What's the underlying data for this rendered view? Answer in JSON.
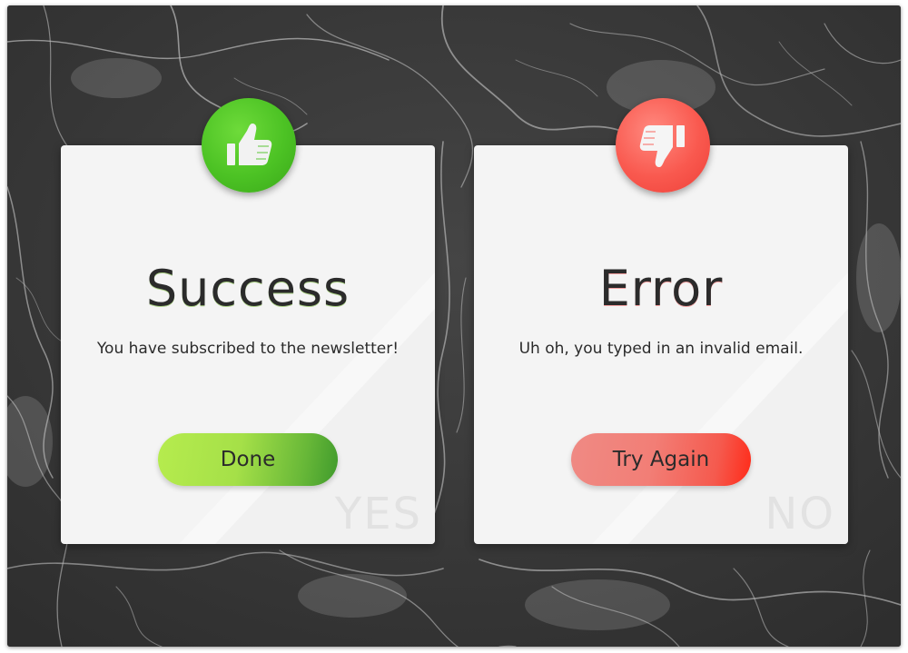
{
  "success_card": {
    "title": "Success",
    "message": "You have subscribed to the newsletter!",
    "button_label": "Done",
    "watermark": "YES",
    "icon": "thumbs-up-icon",
    "accent_color": "#4cc224"
  },
  "error_card": {
    "title": "Error",
    "message": "Uh oh, you typed in an invalid email.",
    "button_label": "Try Again",
    "watermark": "NO",
    "icon": "thumbs-down-icon",
    "accent_color": "#f9594f"
  },
  "colors": {
    "background": "#3a3a3a",
    "card": "#f4f4f4",
    "text": "#2b2b2b"
  }
}
